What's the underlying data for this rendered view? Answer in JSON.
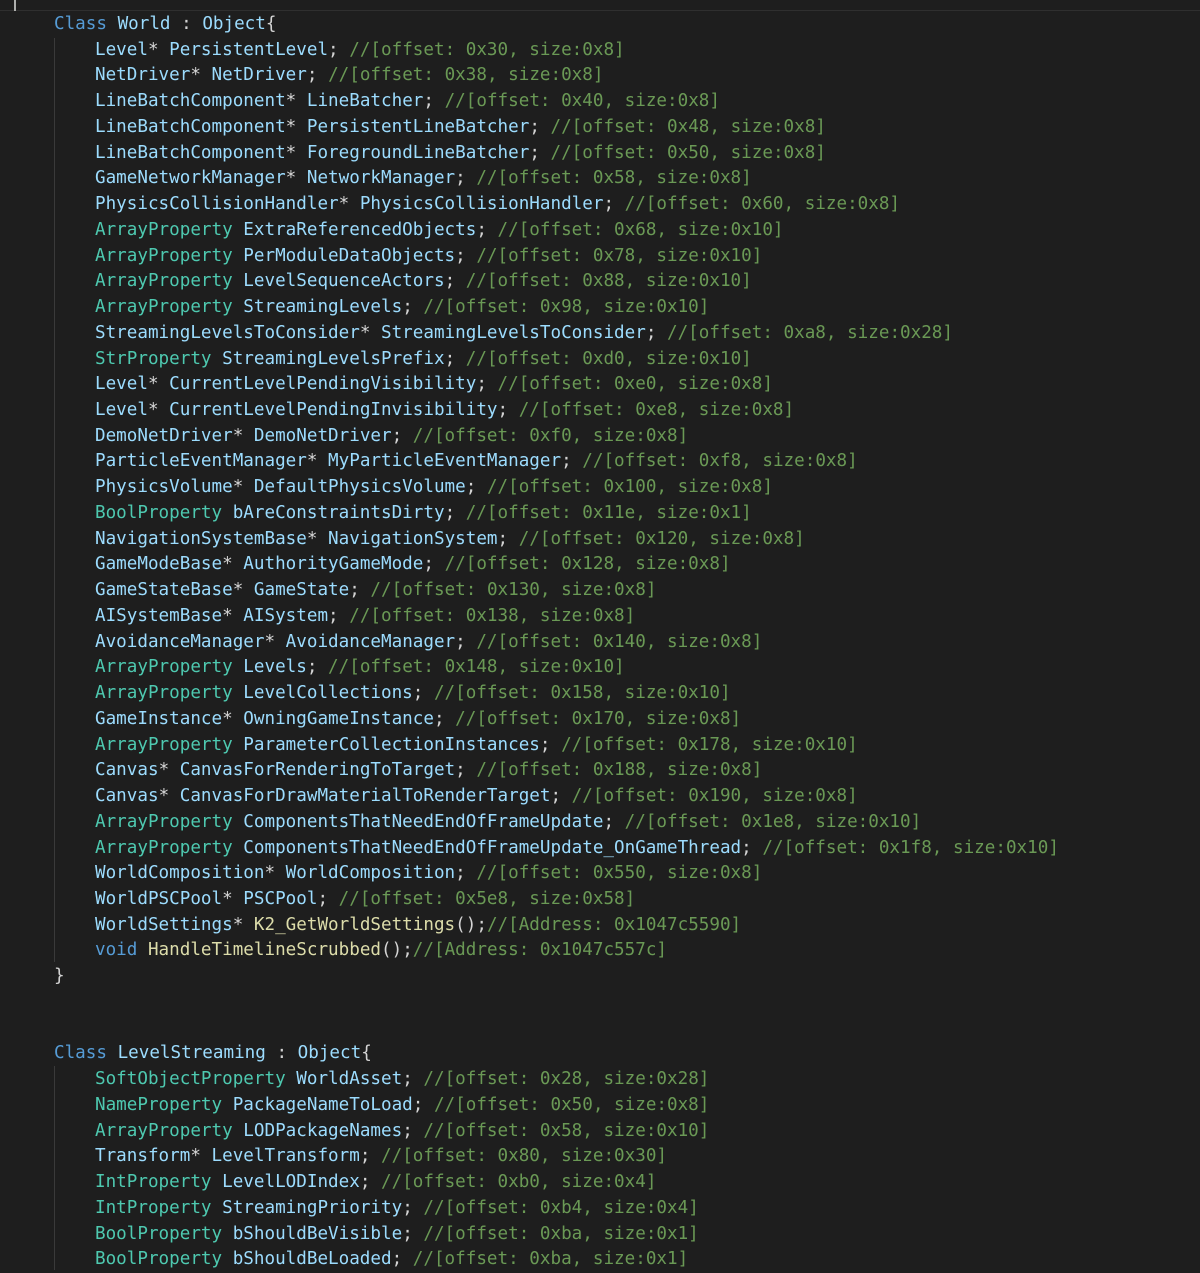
{
  "editor": {
    "theme_colors": {
      "background": "#1e1e1e",
      "keyword": "#569cd6",
      "type": "#4ec9b0",
      "identifier": "#9cdcfe",
      "function": "#dcdcaa",
      "comment": "#6a9955",
      "text": "#d4d4d4"
    }
  },
  "blocks": [
    {
      "keyword": "Class",
      "name": "World",
      "base": "Object",
      "members": [
        {
          "type": "Level*",
          "name": "PersistentLevel",
          "comment": "//[offset: 0x30, size:0x8]"
        },
        {
          "type": "NetDriver*",
          "name": "NetDriver",
          "comment": "//[offset: 0x38, size:0x8]"
        },
        {
          "type": "LineBatchComponent*",
          "name": "LineBatcher",
          "comment": "//[offset: 0x40, size:0x8]"
        },
        {
          "type": "LineBatchComponent*",
          "name": "PersistentLineBatcher",
          "comment": "//[offset: 0x48, size:0x8]"
        },
        {
          "type": "LineBatchComponent*",
          "name": "ForegroundLineBatcher",
          "comment": "//[offset: 0x50, size:0x8]"
        },
        {
          "type": "GameNetworkManager*",
          "name": "NetworkManager",
          "comment": "//[offset: 0x58, size:0x8]"
        },
        {
          "type": "PhysicsCollisionHandler*",
          "name": "PhysicsCollisionHandler",
          "comment": "//[offset: 0x60, size:0x8]"
        },
        {
          "type": "ArrayProperty",
          "name": "ExtraReferencedObjects",
          "comment": "//[offset: 0x68, size:0x10]"
        },
        {
          "type": "ArrayProperty",
          "name": "PerModuleDataObjects",
          "comment": "//[offset: 0x78, size:0x10]"
        },
        {
          "type": "ArrayProperty",
          "name": "LevelSequenceActors",
          "comment": "//[offset: 0x88, size:0x10]"
        },
        {
          "type": "ArrayProperty",
          "name": "StreamingLevels",
          "comment": "//[offset: 0x98, size:0x10]"
        },
        {
          "type": "StreamingLevelsToConsider*",
          "name": "StreamingLevelsToConsider",
          "comment": "//[offset: 0xa8, size:0x28]"
        },
        {
          "type": "StrProperty",
          "name": "StreamingLevelsPrefix",
          "comment": "//[offset: 0xd0, size:0x10]"
        },
        {
          "type": "Level*",
          "name": "CurrentLevelPendingVisibility",
          "comment": "//[offset: 0xe0, size:0x8]"
        },
        {
          "type": "Level*",
          "name": "CurrentLevelPendingInvisibility",
          "comment": "//[offset: 0xe8, size:0x8]"
        },
        {
          "type": "DemoNetDriver*",
          "name": "DemoNetDriver",
          "comment": "//[offset: 0xf0, size:0x8]"
        },
        {
          "type": "ParticleEventManager*",
          "name": "MyParticleEventManager",
          "comment": "//[offset: 0xf8, size:0x8]"
        },
        {
          "type": "PhysicsVolume*",
          "name": "DefaultPhysicsVolume",
          "comment": "//[offset: 0x100, size:0x8]"
        },
        {
          "type": "BoolProperty",
          "name": "bAreConstraintsDirty",
          "comment": "//[offset: 0x11e, size:0x1]"
        },
        {
          "type": "NavigationSystemBase*",
          "name": "NavigationSystem",
          "comment": "//[offset: 0x120, size:0x8]"
        },
        {
          "type": "GameModeBase*",
          "name": "AuthorityGameMode",
          "comment": "//[offset: 0x128, size:0x8]"
        },
        {
          "type": "GameStateBase*",
          "name": "GameState",
          "comment": "//[offset: 0x130, size:0x8]"
        },
        {
          "type": "AISystemBase*",
          "name": "AISystem",
          "comment": "//[offset: 0x138, size:0x8]"
        },
        {
          "type": "AvoidanceManager*",
          "name": "AvoidanceManager",
          "comment": "//[offset: 0x140, size:0x8]"
        },
        {
          "type": "ArrayProperty",
          "name": "Levels",
          "comment": "//[offset: 0x148, size:0x10]"
        },
        {
          "type": "ArrayProperty",
          "name": "LevelCollections",
          "comment": "//[offset: 0x158, size:0x10]"
        },
        {
          "type": "GameInstance*",
          "name": "OwningGameInstance",
          "comment": "//[offset: 0x170, size:0x8]"
        },
        {
          "type": "ArrayProperty",
          "name": "ParameterCollectionInstances",
          "comment": "//[offset: 0x178, size:0x10]"
        },
        {
          "type": "Canvas*",
          "name": "CanvasForRenderingToTarget",
          "comment": "//[offset: 0x188, size:0x8]"
        },
        {
          "type": "Canvas*",
          "name": "CanvasForDrawMaterialToRenderTarget",
          "comment": "//[offset: 0x190, size:0x8]"
        },
        {
          "type": "ArrayProperty",
          "name": "ComponentsThatNeedEndOfFrameUpdate",
          "comment": "//[offset: 0x1e8, size:0x10]"
        },
        {
          "type": "ArrayProperty",
          "name": "ComponentsThatNeedEndOfFrameUpdate_OnGameThread",
          "comment": "//[offset: 0x1f8, size:0x10]"
        },
        {
          "type": "WorldComposition*",
          "name": "WorldComposition",
          "comment": "//[offset: 0x550, size:0x8]"
        },
        {
          "type": "WorldPSCPool*",
          "name": "PSCPool",
          "comment": "//[offset: 0x5e8, size:0x58]"
        }
      ],
      "methods": [
        {
          "ret": "WorldSettings*",
          "name": "K2_GetWorldSettings",
          "comment": "//[Address: 0x1047c5590]"
        },
        {
          "ret": "void",
          "name": "HandleTimelineScrubbed",
          "comment": "//[Address: 0x1047c557c]"
        }
      ]
    },
    {
      "keyword": "Class",
      "name": "LevelStreaming",
      "base": "Object",
      "members": [
        {
          "type": "SoftObjectProperty",
          "name": "WorldAsset",
          "comment": "//[offset: 0x28, size:0x28]"
        },
        {
          "type": "NameProperty",
          "name": "PackageNameToLoad",
          "comment": "//[offset: 0x50, size:0x8]"
        },
        {
          "type": "ArrayProperty",
          "name": "LODPackageNames",
          "comment": "//[offset: 0x58, size:0x10]"
        },
        {
          "type": "Transform*",
          "name": "LevelTransform",
          "comment": "//[offset: 0x80, size:0x30]"
        },
        {
          "type": "IntProperty",
          "name": "LevelLODIndex",
          "comment": "//[offset: 0xb0, size:0x4]"
        },
        {
          "type": "IntProperty",
          "name": "StreamingPriority",
          "comment": "//[offset: 0xb4, size:0x4]"
        },
        {
          "type": "BoolProperty",
          "name": "bShouldBeVisible",
          "comment": "//[offset: 0xba, size:0x1]"
        },
        {
          "type": "BoolProperty",
          "name": "bShouldBeLoaded",
          "comment": "//[offset: 0xba, size:0x1]"
        }
      ],
      "methods": []
    }
  ]
}
